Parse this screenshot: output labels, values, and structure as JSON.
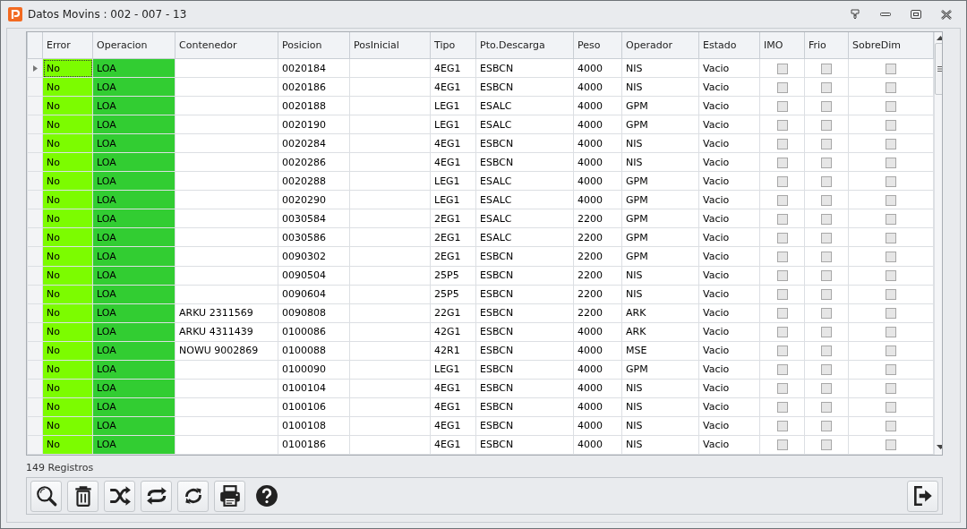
{
  "window": {
    "title": "Datos Movins : 002 - 007 - 13"
  },
  "table": {
    "columns": [
      "Error",
      "Operacion",
      "Contenedor",
      "Posicion",
      "PosInicial",
      "Tipo",
      "Pto.Descarga",
      "Peso",
      "Operador",
      "Estado",
      "IMO",
      "Frio",
      "SobreDim"
    ],
    "rows": [
      {
        "selected": true,
        "error": "No",
        "operacion": "LOA",
        "posicion": "0020184",
        "tipo": "4EG1",
        "pto_descarga": "ESBCN",
        "peso": "4000",
        "operador": "NIS",
        "estado": "Vacio",
        "imo": false,
        "frio": false,
        "sobredim": false
      },
      {
        "selected": false,
        "error": "No",
        "operacion": "LOA",
        "posicion": "0020186",
        "tipo": "4EG1",
        "pto_descarga": "ESBCN",
        "peso": "4000",
        "operador": "NIS",
        "estado": "Vacio",
        "imo": false,
        "frio": false,
        "sobredim": false
      },
      {
        "selected": false,
        "error": "No",
        "operacion": "LOA",
        "posicion": "0020188",
        "tipo": "LEG1",
        "pto_descarga": "ESALC",
        "peso": "4000",
        "operador": "GPM",
        "estado": "Vacio",
        "imo": false,
        "frio": false,
        "sobredim": false
      },
      {
        "selected": false,
        "error": "No",
        "operacion": "LOA",
        "posicion": "0020190",
        "tipo": "LEG1",
        "pto_descarga": "ESALC",
        "peso": "4000",
        "operador": "GPM",
        "estado": "Vacio",
        "imo": false,
        "frio": false,
        "sobredim": false
      },
      {
        "selected": false,
        "error": "No",
        "operacion": "LOA",
        "posicion": "0020284",
        "tipo": "4EG1",
        "pto_descarga": "ESBCN",
        "peso": "4000",
        "operador": "NIS",
        "estado": "Vacio",
        "imo": false,
        "frio": false,
        "sobredim": false
      },
      {
        "selected": false,
        "error": "No",
        "operacion": "LOA",
        "posicion": "0020286",
        "tipo": "4EG1",
        "pto_descarga": "ESBCN",
        "peso": "4000",
        "operador": "NIS",
        "estado": "Vacio",
        "imo": false,
        "frio": false,
        "sobredim": false
      },
      {
        "selected": false,
        "error": "No",
        "operacion": "LOA",
        "posicion": "0020288",
        "tipo": "LEG1",
        "pto_descarga": "ESALC",
        "peso": "4000",
        "operador": "GPM",
        "estado": "Vacio",
        "imo": false,
        "frio": false,
        "sobredim": false
      },
      {
        "selected": false,
        "error": "No",
        "operacion": "LOA",
        "posicion": "0020290",
        "tipo": "LEG1",
        "pto_descarga": "ESALC",
        "peso": "4000",
        "operador": "GPM",
        "estado": "Vacio",
        "imo": false,
        "frio": false,
        "sobredim": false
      },
      {
        "selected": false,
        "error": "No",
        "operacion": "LOA",
        "posicion": "0030584",
        "tipo": "2EG1",
        "pto_descarga": "ESALC",
        "peso": "2200",
        "operador": "GPM",
        "estado": "Vacio",
        "imo": false,
        "frio": false,
        "sobredim": false
      },
      {
        "selected": false,
        "error": "No",
        "operacion": "LOA",
        "posicion": "0030586",
        "tipo": "2EG1",
        "pto_descarga": "ESALC",
        "peso": "2200",
        "operador": "GPM",
        "estado": "Vacio",
        "imo": false,
        "frio": false,
        "sobredim": false
      },
      {
        "selected": false,
        "error": "No",
        "operacion": "LOA",
        "posicion": "0090302",
        "tipo": "2EG1",
        "pto_descarga": "ESBCN",
        "peso": "2200",
        "operador": "GPM",
        "estado": "Vacio",
        "imo": false,
        "frio": false,
        "sobredim": false
      },
      {
        "selected": false,
        "error": "No",
        "operacion": "LOA",
        "posicion": "0090504",
        "tipo": "25P5",
        "pto_descarga": "ESBCN",
        "peso": "2200",
        "operador": "NIS",
        "estado": "Vacio",
        "imo": false,
        "frio": false,
        "sobredim": false
      },
      {
        "selected": false,
        "error": "No",
        "operacion": "LOA",
        "posicion": "0090604",
        "tipo": "25P5",
        "pto_descarga": "ESBCN",
        "peso": "2200",
        "operador": "NIS",
        "estado": "Vacio",
        "imo": false,
        "frio": false,
        "sobredim": false
      },
      {
        "selected": false,
        "error": "No",
        "operacion": "LOA",
        "contenedor": "ARKU 2311569",
        "posicion": "0090808",
        "tipo": "22G1",
        "pto_descarga": "ESBCN",
        "peso": "2200",
        "operador": "ARK",
        "estado": "Vacio",
        "imo": false,
        "frio": false,
        "sobredim": false
      },
      {
        "selected": false,
        "error": "No",
        "operacion": "LOA",
        "contenedor": "ARKU 4311439",
        "posicion": "0100086",
        "tipo": "42G1",
        "pto_descarga": "ESBCN",
        "peso": "4000",
        "operador": "ARK",
        "estado": "Vacio",
        "imo": false,
        "frio": false,
        "sobredim": false
      },
      {
        "selected": false,
        "error": "No",
        "operacion": "LOA",
        "contenedor": "NOWU 9002869",
        "posicion": "0100088",
        "tipo": "42R1",
        "pto_descarga": "ESBCN",
        "peso": "4000",
        "operador": "MSE",
        "estado": "Vacio",
        "imo": false,
        "frio": false,
        "sobredim": false
      },
      {
        "selected": false,
        "error": "No",
        "operacion": "LOA",
        "posicion": "0100090",
        "tipo": "LEG1",
        "pto_descarga": "ESBCN",
        "peso": "4000",
        "operador": "GPM",
        "estado": "Vacio",
        "imo": false,
        "frio": false,
        "sobredim": false
      },
      {
        "selected": false,
        "error": "No",
        "operacion": "LOA",
        "posicion": "0100104",
        "tipo": "4EG1",
        "pto_descarga": "ESBCN",
        "peso": "4000",
        "operador": "NIS",
        "estado": "Vacio",
        "imo": false,
        "frio": false,
        "sobredim": false
      },
      {
        "selected": false,
        "error": "No",
        "operacion": "LOA",
        "posicion": "0100106",
        "tipo": "4EG1",
        "pto_descarga": "ESBCN",
        "peso": "4000",
        "operador": "NIS",
        "estado": "Vacio",
        "imo": false,
        "frio": false,
        "sobredim": false
      },
      {
        "selected": false,
        "error": "No",
        "operacion": "LOA",
        "posicion": "0100108",
        "tipo": "4EG1",
        "pto_descarga": "ESBCN",
        "peso": "4000",
        "operador": "NIS",
        "estado": "Vacio",
        "imo": false,
        "frio": false,
        "sobredim": false
      },
      {
        "selected": false,
        "error": "No",
        "operacion": "LOA",
        "posicion": "0100186",
        "tipo": "4EG1",
        "pto_descarga": "ESBCN",
        "peso": "4000",
        "operador": "NIS",
        "estado": "Vacio",
        "imo": false,
        "frio": false,
        "sobredim": false
      }
    ]
  },
  "status_bar": {
    "record_count": "149 Registros"
  }
}
